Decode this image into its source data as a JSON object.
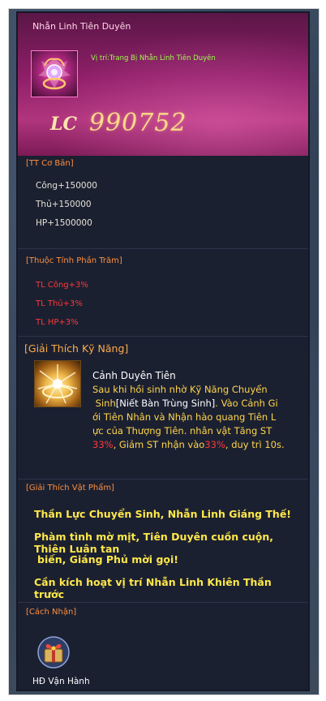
{
  "header": {
    "title": "Nhẫn Linh Tiên Duyên",
    "position_text": "Vị trí:Trang Bị Nhẫn Linh  Tiên Duyên",
    "lc_label": "LC",
    "lc_value": "990752",
    "icon": "ring-item-icon"
  },
  "base_stats": {
    "title": "[TT Cơ Bản]",
    "lines": [
      "Công+150000",
      "Thủ+150000",
      "HP+1500000"
    ]
  },
  "percent_stats": {
    "title": "[Thuộc Tính Phần Trăm]",
    "lines": [
      "TL Công+3%",
      "TL Thủ+3%",
      "TL HP+3%"
    ]
  },
  "skill": {
    "header": "[Giải Thích Kỹ Năng]",
    "name": "Cảnh Duyên Tiên",
    "desc_1": "Sau khi hồi sinh nhờ Kỹ Năng Chuyển",
    "desc_2a": "Sinh",
    "desc_2b": "[Niết Bàn Trùng Sinh]",
    "desc_2c": ". Vào Cảnh Gi",
    "desc_3": "ới Tiên Nhân và Nhận hào quang Tiên L",
    "desc_4": "ực của Thượng Tiên. nhân vật Tăng ST",
    "desc_5a": "33%",
    "desc_5b": ", Giảm ST nhận vào",
    "desc_5c": "33%",
    "desc_5d": ", duy trì 10s.",
    "icon": "skill-aura-icon"
  },
  "item_desc": {
    "title": "[Giải Thích Vật Phẩm]",
    "lines": [
      "Thần Lực Chuyển Sinh, Nhẫn Linh Giáng Thế!",
      "Phàm tình mờ mịt, Tiên Duyên cuồn cuộn, Thiên Luân tan",
      "biến, Giáng Phủ mời gọi!",
      "Cần kích hoạt vị trí Nhẫn Linh Khiên Thần trước"
    ]
  },
  "source": {
    "title": "[Cách Nhận]",
    "label": "HĐ Vận Hành",
    "icon": "event-gift-icon"
  },
  "colors": {
    "header_pink": "#b0357d",
    "panel_bg": "#1b2031",
    "section_orange": "#ff8f3d",
    "stat_red": "#ff3838",
    "desc_yellow": "#ffd54a",
    "position_green": "#9cff4a",
    "lc_gold": "#ffd98c"
  }
}
